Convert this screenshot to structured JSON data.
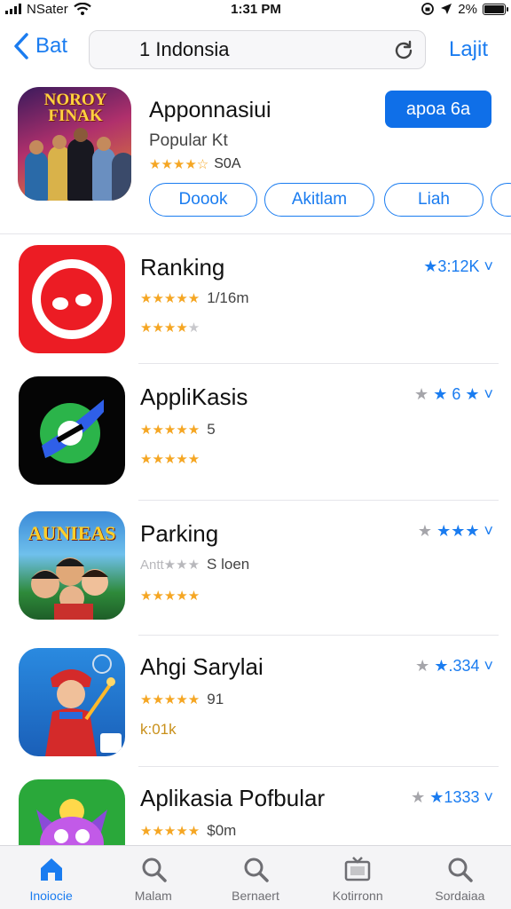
{
  "status_bar": {
    "carrier": "NSater",
    "time": "1:31 PM",
    "battery_text": "2%"
  },
  "nav": {
    "back_label": "Bat",
    "search_value": "1 Indonsia",
    "right_label": "Lajit"
  },
  "featured": {
    "name": "Apponnasiui",
    "subtitle": "Popular Kt",
    "rating_text": "S0A",
    "stars": "★★★★☆",
    "get_label": "apoa 6a",
    "icon_title_1": "NOROY",
    "icon_title_2": "FINAK",
    "chips": [
      "Doook",
      "Akitlam",
      "Liah",
      ""
    ]
  },
  "apps": [
    {
      "name": "Ranking",
      "stars1": "★★★★★",
      "meta": "1/16m",
      "stars2": "★★★★",
      "stars2_dim": "★",
      "rating": "★3:12K ˅"
    },
    {
      "name": "AppliKasis",
      "stars1": "★★★★★",
      "meta": "5",
      "stars2": "★★★★★",
      "stars2_dim": "",
      "rating_gray": "★ ",
      "rating": "★ 6 ★ ˅"
    },
    {
      "name": "Parking",
      "stars1": "Antt★★★",
      "meta": "S loen",
      "stars2": "★★★★★",
      "stars2_dim": "",
      "rating_gray": "★ ",
      "rating": "★★★ ˅",
      "icon_title": "AUNIEAS"
    },
    {
      "name": "Ahgi Sarylai",
      "stars1": "★★★★★",
      "meta": "91",
      "stars2": "k:01k",
      "stars2_dim": "",
      "rating_gray": "★ ",
      "rating": "★.334 ˅"
    },
    {
      "name": "Aplikasia Pofbular",
      "stars1": "★★★★★",
      "meta": "$0m",
      "stars2": "",
      "stars2_dim": "",
      "rating_gray": "★ ",
      "rating": "★1333 ˅"
    }
  ],
  "tabs": [
    {
      "label": "Inoiocie",
      "icon": "home-icon",
      "active": true
    },
    {
      "label": "Malam",
      "icon": "search-icon",
      "active": false
    },
    {
      "label": "Bernaert",
      "icon": "search-icon",
      "active": false
    },
    {
      "label": "Kotirronn",
      "icon": "tv-icon",
      "active": false
    },
    {
      "label": "Sordaiaa",
      "icon": "search-icon",
      "active": false
    }
  ],
  "colors": {
    "accent": "#1a7cf0",
    "star": "#f5a623",
    "divider": "#e5e5ea"
  }
}
